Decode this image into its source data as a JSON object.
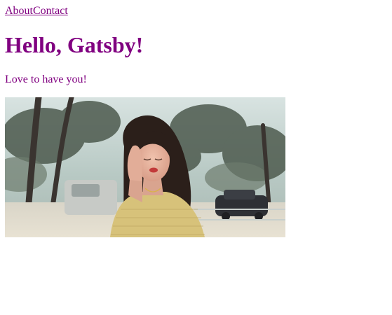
{
  "nav": {
    "links": [
      {
        "label": "About"
      },
      {
        "label": "Contact"
      }
    ]
  },
  "main": {
    "title": "Hello, Gatsby!",
    "tagline": "Love to have you!"
  },
  "hero": {
    "subject": "woman-portrait-photo",
    "colors": {
      "sky": "#c9d9d6",
      "ground": "#e2ddcf",
      "tree": "#3e4a3f",
      "shirt": "#d7c27a",
      "hair": "#2b1f1a",
      "skin": "#e7b39f"
    }
  },
  "theme": {
    "text_color": "#800080"
  }
}
